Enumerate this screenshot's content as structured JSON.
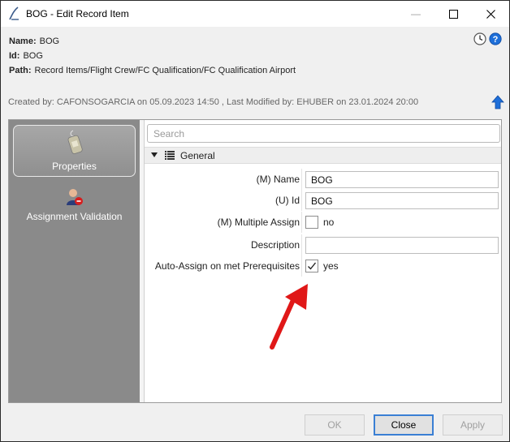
{
  "window": {
    "title": "BOG - Edit Record Item",
    "minimize_glyph": "—",
    "maximize_glyph": "☐",
    "close_glyph": "✕"
  },
  "info": {
    "name_label": "Name:",
    "name_value": "BOG",
    "id_label": "Id:",
    "id_value": "BOG",
    "path_label": "Path:",
    "path_value": "Record Items/Flight Crew/FC Qualification/FC Qualification Airport",
    "created": "Created by: CAFONSOGARCIA on 05.09.2023 14:50 ,  Last Modified by: EHUBER on 23.01.2024 20:00"
  },
  "nav": {
    "items": [
      {
        "label": "Properties",
        "icon": "luggage-tag-icon",
        "selected": true
      },
      {
        "label": "Assignment Validation",
        "icon": "user-validation-icon",
        "selected": false
      }
    ]
  },
  "search": {
    "placeholder": "Search",
    "value": ""
  },
  "group": {
    "title": "General",
    "expanded": true
  },
  "fields": [
    {
      "label": "(M) Name",
      "type": "text",
      "value": "BOG"
    },
    {
      "label": "(U) Id",
      "type": "text",
      "value": "BOG"
    },
    {
      "label": "(M) Multiple Assign",
      "type": "checkbox",
      "checked": false,
      "text": "no"
    },
    {
      "label": "Description",
      "type": "text",
      "value": ""
    },
    {
      "label": "Auto-Assign on met Prerequisites",
      "type": "checkbox",
      "checked": true,
      "text": "yes"
    }
  ],
  "buttons": {
    "ok": "OK",
    "close": "Close",
    "apply": "Apply"
  },
  "colors": {
    "accent_blue": "#1e6fd9",
    "annotation_red": "#e01818",
    "nav_bg": "#8a8a8a"
  }
}
